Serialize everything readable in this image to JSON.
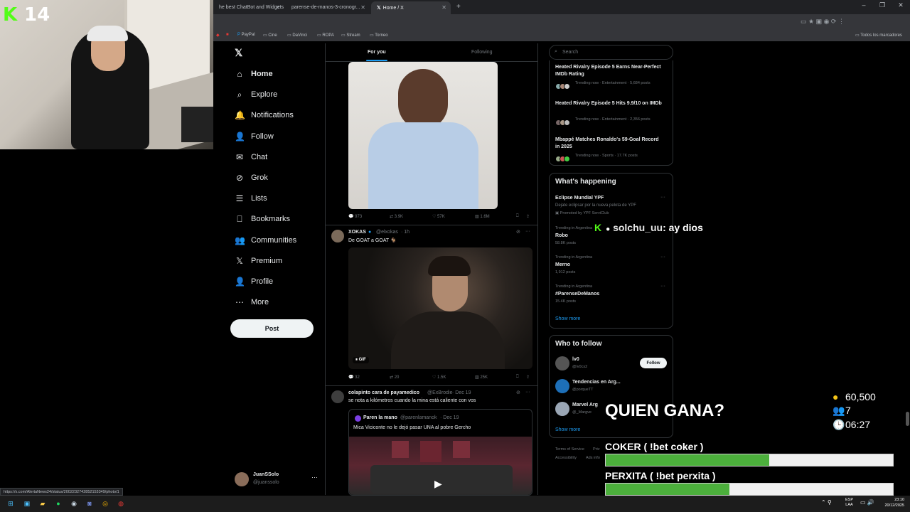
{
  "browser": {
    "tabs": [
      {
        "label": "he best ChatBot and Widgets"
      },
      {
        "label": "parense-de-manos-3-cronogr..."
      },
      {
        "label": "Home / X",
        "active": true
      }
    ],
    "new_tab": "+",
    "window_controls": [
      "–",
      "❐",
      "✕"
    ],
    "bookmarks": [
      {
        "label": "PayPal",
        "icon": "paypal-icon"
      },
      {
        "label": "Cine",
        "icon": "folder-icon"
      },
      {
        "label": "DaVinci",
        "icon": "folder-icon"
      },
      {
        "label": "ROPA",
        "icon": "folder-icon"
      },
      {
        "label": "Stream",
        "icon": "folder-icon"
      },
      {
        "label": "Torneo",
        "icon": "folder-icon"
      }
    ],
    "all_bookmarks": "Todos los marcadores",
    "status_url": "https://x.com/AlertaNews24/status/2002232742852153349/photo/1"
  },
  "stream": {
    "kick_count": "14"
  },
  "nav": {
    "items": [
      {
        "label": "Home",
        "icon": "home-icon",
        "bold": true
      },
      {
        "label": "Explore",
        "icon": "search-icon"
      },
      {
        "label": "Notifications",
        "icon": "bell-icon"
      },
      {
        "label": "Follow",
        "icon": "person-plus-icon"
      },
      {
        "label": "Chat",
        "icon": "mail-icon"
      },
      {
        "label": "Grok",
        "icon": "grok-icon"
      },
      {
        "label": "Lists",
        "icon": "list-icon"
      },
      {
        "label": "Bookmarks",
        "icon": "bookmark-icon"
      },
      {
        "label": "Communities",
        "icon": "communities-icon"
      },
      {
        "label": "Premium",
        "icon": "x-icon"
      },
      {
        "label": "Profile",
        "icon": "profile-icon"
      },
      {
        "label": "More",
        "icon": "more-icon"
      }
    ],
    "post_label": "Post",
    "account": {
      "name": "JuanSSolo",
      "handle": "@juanssolo",
      "menu": "···"
    }
  },
  "feed": {
    "tabs": {
      "for_you": "For you",
      "following": "Following"
    },
    "tweet1_actions": {
      "replies": "973",
      "retweets": "3.9K",
      "likes": "57K",
      "views": "1.6M"
    },
    "tweet2": {
      "name": "XOKAS",
      "handle": "@elxokas",
      "time": "1h",
      "text": "De GOAT a GOAT 🐐",
      "gif_label": "GIF",
      "actions": {
        "replies": "32",
        "retweets": "20",
        "likes": "1.5K",
        "views": "25K"
      }
    },
    "tweet3": {
      "name": "colapinto cara de payamedico",
      "handle": "@ExBrodie",
      "time": "Dec 19",
      "text": "se nota a kilómetros cuando la mina está caliente con vos",
      "quote": {
        "name": "Paren la mano",
        "handle": "@parenlamanok",
        "time": "Dec 19",
        "text": "Mica Viciconte no le dejó pasar UNA al pobre Gercho"
      }
    }
  },
  "sidebar": {
    "search_placeholder": "Search",
    "trending_top": [
      {
        "title": "Heated Rivalry Episode 5 Earns Near-Perfect IMDb Rating",
        "sub": "Trending now · Entertainment · 5,684 posts"
      },
      {
        "title": "Heated Rivalry Episode 5 Hits 9.9/10 on IMDb",
        "sub": "Trending now · Entertainment · 2,356 posts"
      },
      {
        "title": "Mbappé Matches Ronaldo's 59-Goal Record in 2025",
        "sub": "Trending now · Sports · 17.7K posts"
      }
    ],
    "whats_happening": {
      "title": "What's happening",
      "promo": {
        "title": "Eclipse Mundial YPF",
        "desc": "Dejate eclipsar por la nueva pelota de YPF",
        "promoted": "Promoted by YPF ServiClub"
      },
      "items": [
        {
          "category": "Trending in Argentina",
          "title": "Robo",
          "count": "58.8K posts"
        },
        {
          "category": "Trending in Argentina",
          "title": "Merno",
          "count": "1,912 posts"
        },
        {
          "category": "Trending in Argentina",
          "title": "#ParenseDeManos",
          "count": "15.4K posts"
        }
      ],
      "show_more": "Show more"
    },
    "who_to_follow": {
      "title": "Who to follow",
      "accounts": [
        {
          "name": "lv0",
          "handle": "@lv0cs2",
          "button": "Follow"
        },
        {
          "name": "Tendencias en Arg...",
          "handle": "@porqueTT"
        },
        {
          "name": "Marvel Arg",
          "handle": "@_Margve"
        }
      ],
      "show_more": "Show more"
    },
    "footer": [
      "Terms of Service",
      "Priv",
      "Accessibility",
      "Ads info"
    ]
  },
  "overlay": {
    "chat": {
      "user": "solchu_uu",
      "message": ": ay dios"
    },
    "bet": {
      "question": "QUIEN GANA?",
      "points": "60,500",
      "voters": "7",
      "timer": "06:27",
      "options": [
        {
          "label": "COKER ( !bet coker )",
          "fraction": 0.57
        },
        {
          "label": "PERXITA ( !bet perxita )",
          "fraction": 0.43
        }
      ]
    }
  },
  "taskbar": {
    "lang": "ESP",
    "lang2": "LAA",
    "time": "23:10",
    "date": "20/12/2025"
  },
  "colors": {
    "accent": "#1d9bf0",
    "kick_green": "#53fc18",
    "bar_green": "#4caf3c"
  }
}
